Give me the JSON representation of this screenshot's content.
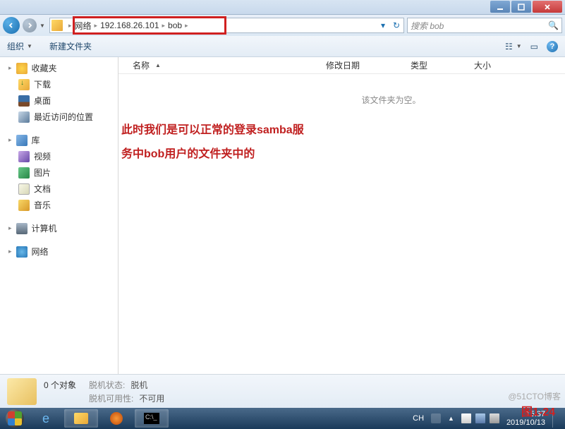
{
  "breadcrumb": {
    "root": "网络",
    "ip": "192.168.26.101",
    "folder": "bob"
  },
  "search": {
    "placeholder": "搜索 bob"
  },
  "toolbar": {
    "organize": "组织",
    "newfolder": "新建文件夹"
  },
  "columns": {
    "name": "名称",
    "date": "修改日期",
    "type": "类型",
    "size": "大小"
  },
  "content": {
    "empty": "该文件夹为空。",
    "annotation_l1": "此时我们是可以正常的登录samba服",
    "annotation_l2": "务中bob用户的文件夹中的"
  },
  "sidebar": {
    "favorites": "收藏夹",
    "downloads": "下载",
    "desktop": "桌面",
    "recent": "最近访问的位置",
    "libraries": "库",
    "videos": "视频",
    "pictures": "图片",
    "documents": "文档",
    "music": "音乐",
    "computer": "计算机",
    "network": "网络"
  },
  "status": {
    "count": "0 个对象",
    "offline_label": "脱机状态:",
    "offline_value": "脱机",
    "avail_label": "脱机可用性:",
    "avail_value": "不可用"
  },
  "figure": "图1-24",
  "taskbar": {
    "ime": "CH",
    "time": "15:37",
    "date": "2019/10/13"
  },
  "watermark": "@51CTO博客"
}
